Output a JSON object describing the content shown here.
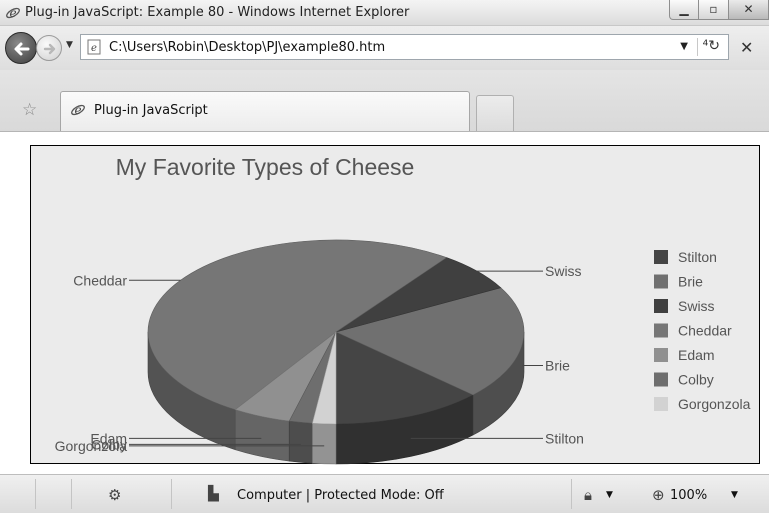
{
  "window": {
    "title": "Plug-in JavaScript: Example 80 - Windows Internet Explorer",
    "icons": {
      "app": "ie-logo-icon",
      "minimize": "minimize-icon",
      "maximize": "maximize-icon",
      "close": "close-icon"
    }
  },
  "address_bar": {
    "url": "C:\\Users\\Robin\\Desktop\\PJ\\example80.htm",
    "icons": {
      "back": "back-arrow-icon",
      "forward": "forward-arrow-icon",
      "page": "ie-page-icon",
      "refresh": "refresh-icon",
      "stop": "stop-icon"
    }
  },
  "tabs": [
    {
      "label": "Plug-in JavaScript"
    }
  ],
  "status_bar": {
    "zone": "Computer | Protected Mode: Off",
    "zoom": "100%"
  },
  "colors": {
    "stilton": "#454545",
    "brie": "#707070",
    "swiss": "#404040",
    "cheddar": "#767676",
    "edam": "#909090",
    "colby": "#6e6e6e",
    "gorgonzola": "#d2d2d2"
  },
  "chart_data": {
    "type": "pie",
    "title": "My Favorite Types of Cheese",
    "style": "3d",
    "legend_position": "right",
    "categories": [
      "Stilton",
      "Brie",
      "Swiss",
      "Cheddar",
      "Edam",
      "Colby",
      "Gorgonzola"
    ],
    "values": [
      13,
      20,
      7,
      51,
      5,
      2,
      2
    ]
  }
}
